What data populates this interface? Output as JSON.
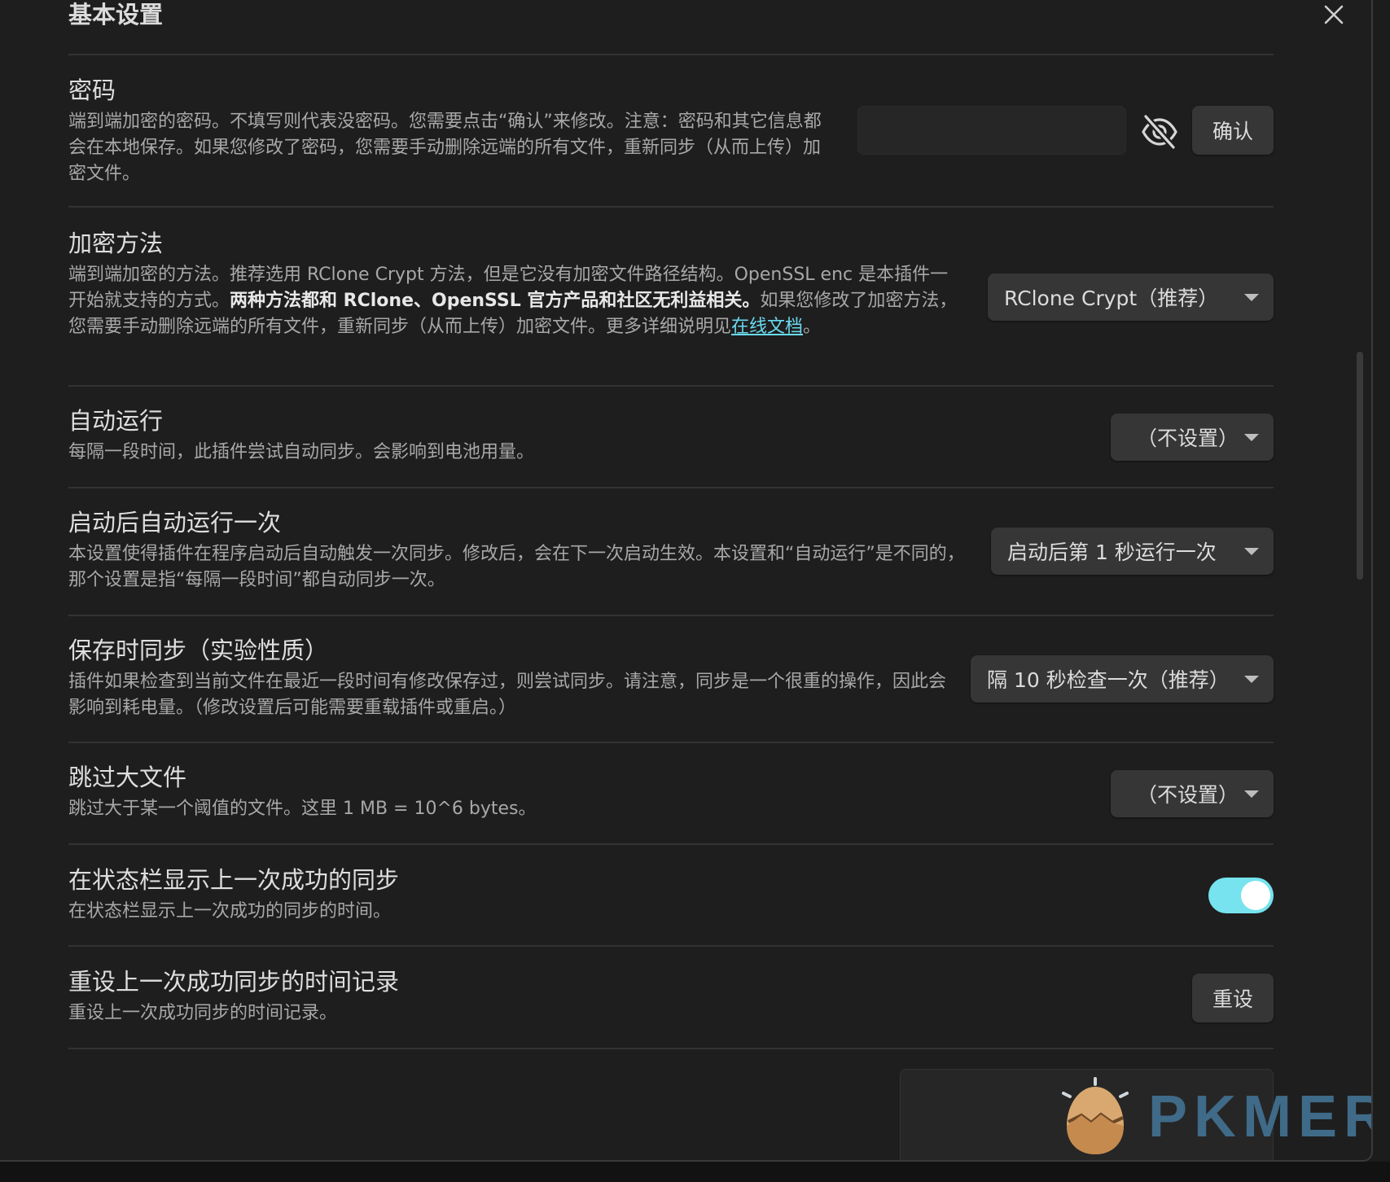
{
  "header": {
    "title": "基本设置"
  },
  "password": {
    "name": "密码",
    "desc": "端到端加密的密码。不填写则代表没密码。您需要点击“确认”来修改。注意：密码和其它信息都会在本地保存。如果您修改了密码，您需要手动删除远端的所有文件，重新同步（从而上传）加密文件。",
    "input_value": "",
    "confirm_label": "确认"
  },
  "encryption": {
    "name": "加密方法",
    "desc_1": "端到端加密的方法。推荐选用 RClone Crypt 方法，但是它没有加密文件路径结构。OpenSSL enc 是本插件一开始就支持的方式。",
    "desc_bold": "两种方法都和 RClone、OpenSSL 官方产品和社区无利益相关。",
    "desc_2": "如果您修改了加密方法，您需要手动删除远端的所有文件，重新同步（从而上传）加密文件。更多详细说明见",
    "desc_link": "在线文档",
    "desc_end": "。",
    "selected": "RClone Crypt（推荐）"
  },
  "autorun": {
    "name": "自动运行",
    "desc": "每隔一段时间，此插件尝试自动同步。会影响到电池用量。",
    "selected": "（不设置）"
  },
  "startup": {
    "name": "启动后自动运行一次",
    "desc": "本设置使得插件在程序启动后自动触发一次同步。修改后，会在下一次启动生效。本设置和“自动运行”是不同的，那个设置是指“每隔一段时间”都自动同步一次。",
    "selected": "启动后第 1 秒运行一次"
  },
  "save_sync": {
    "name": "保存时同步（实验性质）",
    "desc": "插件如果检查到当前文件在最近一段时间有修改保存过，则尝试同步。请注意，同步是一个很重的操作，因此会影响到耗电量。（修改设置后可能需要重载插件或重启。）",
    "selected": "隔 10 秒检查一次（推荐）"
  },
  "skip_large": {
    "name": "跳过大文件",
    "desc": "跳过大于某一个阈值的文件。这里 1 MB = 10^6 bytes。",
    "selected": "（不设置）"
  },
  "statusbar": {
    "name": "在状态栏显示上一次成功的同步",
    "desc": "在状态栏显示上一次成功的同步的时间。",
    "enabled": true
  },
  "reset": {
    "name": "重设上一次成功同步的时间记录",
    "desc": "重设上一次成功同步的时间记录。",
    "button_label": "重设"
  },
  "watermark": {
    "text": "PKMER"
  },
  "colors": {
    "accent": "#76e3ee",
    "link": "#6ad9ef",
    "background": "#1e1e1e"
  }
}
